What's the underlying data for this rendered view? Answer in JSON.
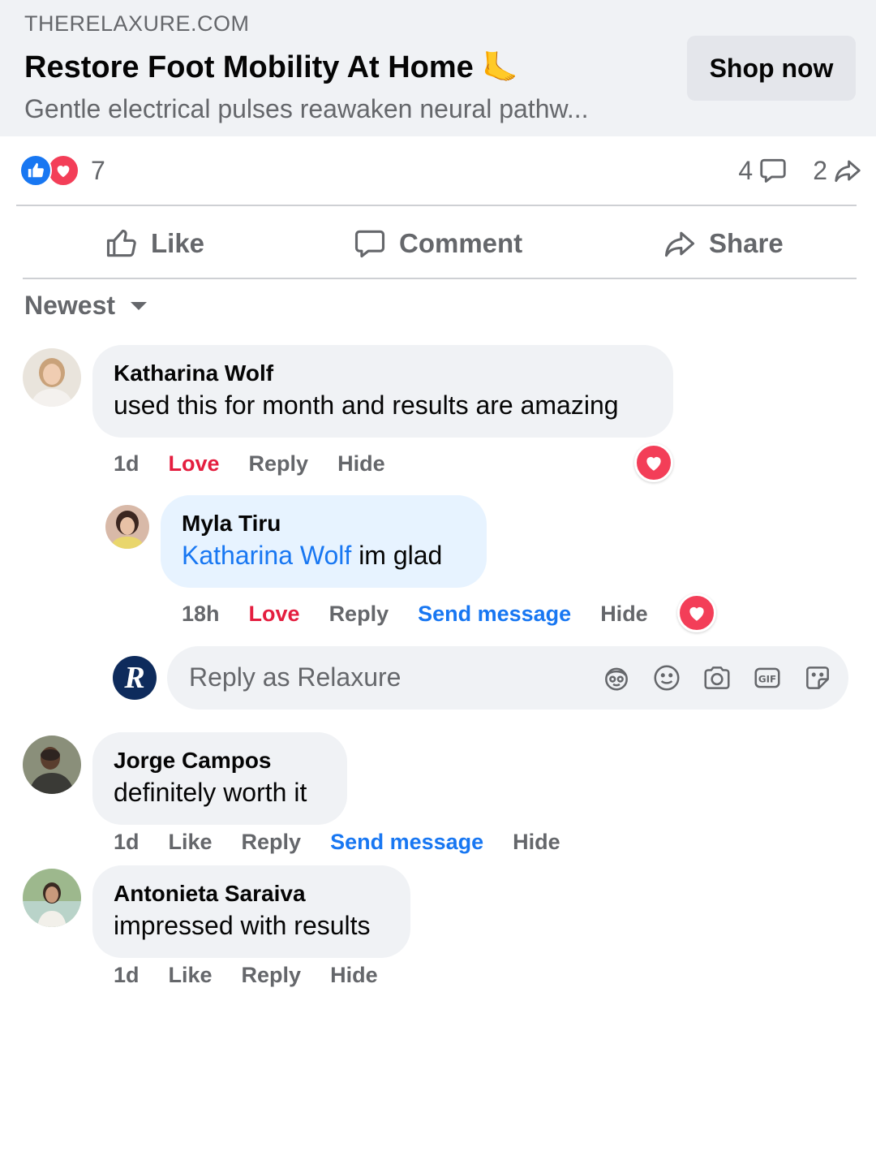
{
  "ad": {
    "domain": "THERELAXURE.COM",
    "title": "Restore Foot Mobility At Home",
    "title_emoji": "🦶",
    "subtitle": "Gentle electrical pulses reawaken neural pathw...",
    "shop_label": "Shop now"
  },
  "reactions": {
    "count": "7",
    "types": [
      "like",
      "love"
    ]
  },
  "stats": {
    "comments": "4",
    "shares": "2"
  },
  "actions": {
    "like": "Like",
    "comment": "Comment",
    "share": "Share"
  },
  "sort": {
    "label": "Newest"
  },
  "comments": [
    {
      "name": "Katharina Wolf",
      "text": "used this for month and results are amazing",
      "time": "1d",
      "reaction_link": "Love",
      "reply": "Reply",
      "hide": "Hide",
      "reaction": "love"
    },
    {
      "name": "Myla Tiru",
      "mention": "Katharina Wolf",
      "text": " im glad",
      "time": "18h",
      "reaction_link": "Love",
      "reply": "Reply",
      "send_message": "Send message",
      "hide": "Hide",
      "reaction": "love"
    },
    {
      "name": "Jorge Campos",
      "text": "definitely worth it",
      "time": "1d",
      "reaction_link": "Like",
      "reply": "Reply",
      "send_message": "Send message",
      "hide": "Hide"
    },
    {
      "name": "Antonieta Saraiva",
      "text": "impressed with results",
      "time": "1d",
      "reaction_link": "Like",
      "reply": "Reply",
      "hide": "Hide"
    }
  ],
  "reply_box": {
    "placeholder": "Reply as Relaxure",
    "page_initial": "R",
    "icons": [
      "avatar-sticker-icon",
      "emoji-icon",
      "camera-icon",
      "gif-icon",
      "sticker-icon"
    ]
  },
  "colors": {
    "accent": "#1877f2",
    "love": "#e41e3f",
    "muted": "#65676b",
    "bubble": "#f0f2f5"
  }
}
